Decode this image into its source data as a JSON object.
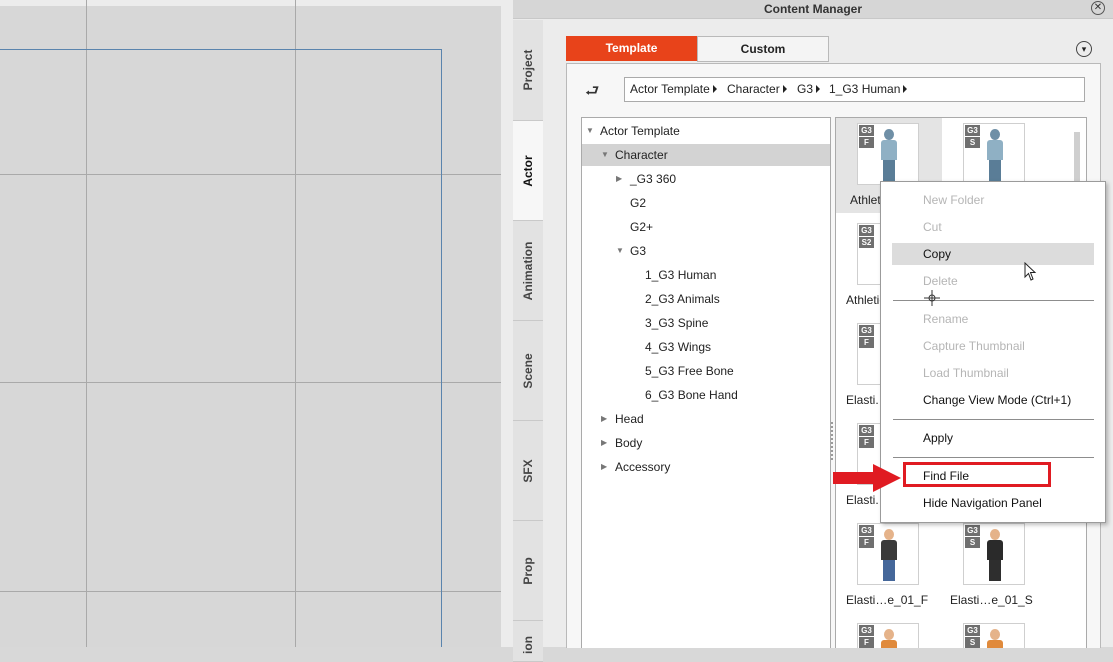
{
  "window": {
    "title": "Content Manager",
    "close_glyph": "✕"
  },
  "side_tabs": [
    "Project",
    "Actor",
    "Animation",
    "Scene",
    "SFX",
    "Prop",
    "ion"
  ],
  "active_side_tab": "Actor",
  "top_tabs": {
    "template": "Template",
    "custom": "Custom"
  },
  "colors": {
    "accent": "#e8431a",
    "highlight_box": "#e01b22"
  },
  "breadcrumb": [
    "Actor Template",
    "Character",
    "G3",
    "1_G3 Human"
  ],
  "tree": [
    {
      "label": "Actor Template",
      "expanded": true
    },
    {
      "label": "Character",
      "expanded": true,
      "selected": true
    },
    {
      "label": "_G3 360",
      "expanded": false
    },
    {
      "label": "G2"
    },
    {
      "label": "G2+"
    },
    {
      "label": "G3",
      "expanded": true
    },
    {
      "label": "1_G3 Human"
    },
    {
      "label": "2_G3 Animals"
    },
    {
      "label": "3_G3 Spine"
    },
    {
      "label": "4_G3 Wings"
    },
    {
      "label": "5_G3 Free Bone"
    },
    {
      "label": "6_G3 Bone Hand"
    },
    {
      "label": "Head",
      "expanded": false
    },
    {
      "label": "Body",
      "expanded": false
    },
    {
      "label": "Accessory",
      "expanded": false
    }
  ],
  "items": [
    {
      "label": "Athleti",
      "badges": [
        "G3",
        "F"
      ]
    },
    {
      "label": "",
      "badges": [
        "G3",
        "S"
      ]
    },
    {
      "label": "Athletic",
      "badges": [
        "G3",
        "S2"
      ]
    },
    {
      "label": "Elasti.",
      "badges": [
        "G3",
        "F"
      ]
    },
    {
      "label": "Elasti.",
      "badges": [
        "G3",
        "F"
      ]
    },
    {
      "label": "Elasti…e_01_F",
      "badges": [
        "G3",
        "F"
      ]
    },
    {
      "label": "Elasti…e_01_S",
      "badges": [
        "G3",
        "S"
      ]
    },
    {
      "label": "",
      "badges": [
        "G3",
        "F"
      ]
    },
    {
      "label": "",
      "badges": [
        "G3",
        "S"
      ]
    }
  ],
  "context_menu": {
    "new_folder": "New Folder",
    "cut": "Cut",
    "copy": "Copy",
    "delete": "Delete",
    "rename": "Rename",
    "capture_thumbnail": "Capture Thumbnail",
    "load_thumbnail": "Load Thumbnail",
    "change_view_mode": "Change View Mode (Ctrl+1)",
    "apply": "Apply",
    "find_file": "Find File",
    "hide_navigation_panel": "Hide Navigation Panel"
  }
}
